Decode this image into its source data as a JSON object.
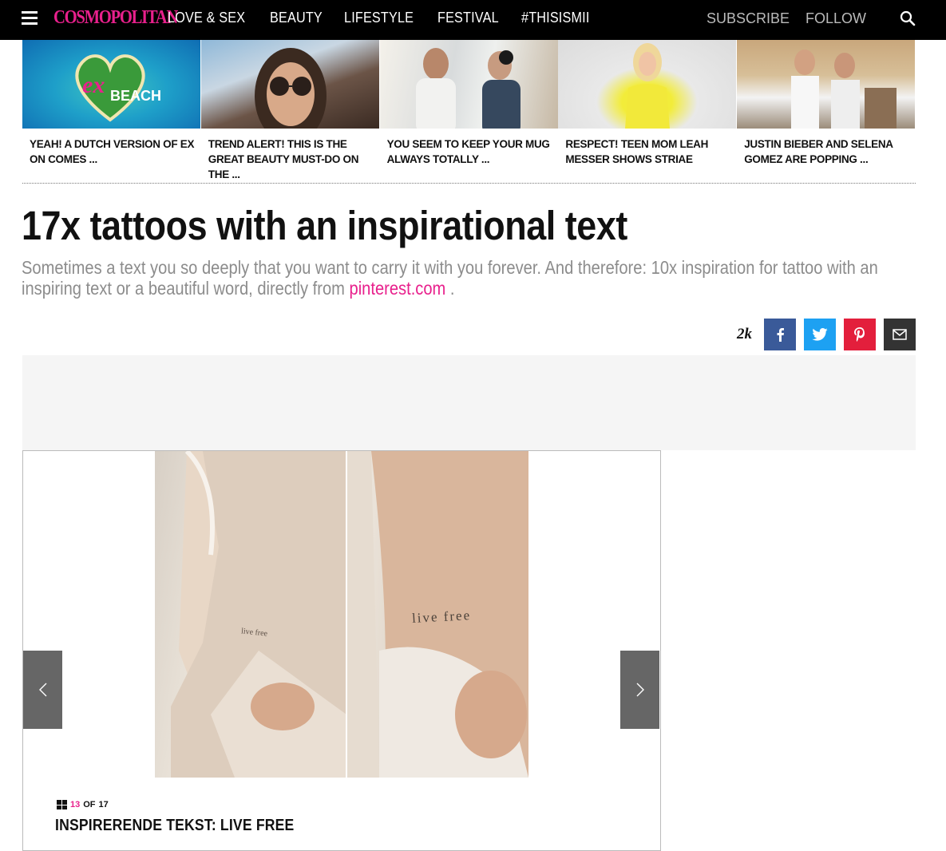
{
  "nav": {
    "logo": "COSMOPOLITAN",
    "links": [
      "LOVE & SEX",
      "BEAUTY",
      "LIFESTYLE",
      "FESTIVAL",
      "#THISISMII"
    ],
    "subscribe": "SUBSCRIBE",
    "follow": "FOLLOW",
    "icons": [
      "hamburger-menu-icon",
      "search-icon"
    ],
    "brand_color": "#e8208c"
  },
  "trending": [
    {
      "caption": "YEAH! A DUTCH VERSION OF EX ON COMES ...",
      "image_text_1": "ex",
      "image_text_2": "BEACH"
    },
    {
      "caption": "TREND ALERT! THIS IS THE GREAT BEAUTY MUST-DO ON THE ..."
    },
    {
      "caption": "YOU SEEM TO KEEP YOUR MUG ALWAYS TOTALLY ..."
    },
    {
      "caption": "RESPECT! TEEN MOM LEAH MESSER SHOWS STRIAE"
    },
    {
      "caption": "JUSTIN BIEBER AND SELENA GOMEZ ARE POPPING ..."
    }
  ],
  "article": {
    "headline": "17x tattoos with an inspirational text",
    "intro": "Sometimes a text you so deeply that you want to carry it with you forever. And therefore: 10x inspiration for tattoo with an inspiring text or a beautiful word, directly from ",
    "intro_link": "pinterest.com",
    "intro_end": " ."
  },
  "share": {
    "count": "2k",
    "buttons": [
      "facebook-icon",
      "twitter-icon",
      "pinterest-icon",
      "email-icon"
    ],
    "colors": {
      "facebook": "#3a5a99",
      "twitter": "#1da1f2",
      "pinterest": "#e31f3c",
      "email": "#333333"
    }
  },
  "gallery": {
    "tattoo_text_left": "live free",
    "tattoo_text_right": "live free",
    "current": "13",
    "of_label": "OF",
    "total": "17",
    "slide_title": "INSPIRERENDE TEKST: LIVE FREE"
  }
}
